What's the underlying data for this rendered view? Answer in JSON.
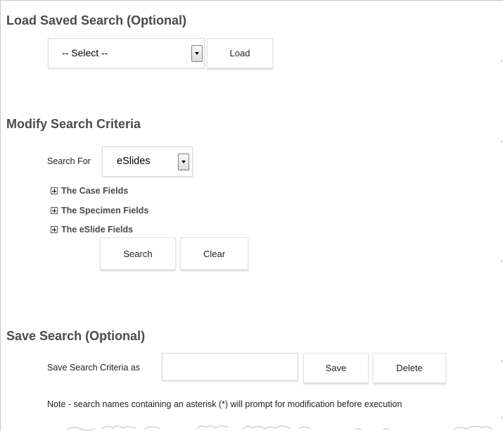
{
  "load_section": {
    "title": "Load Saved Search (Optional)",
    "select_value": "-- Select --",
    "load_button": "Load"
  },
  "modify_section": {
    "title": "Modify Search Criteria",
    "search_for_label": "Search For",
    "search_for_value": "eSlides",
    "tree_items": [
      "The Case Fields",
      "The Specimen Fields",
      "The eSlide Fields"
    ],
    "search_button": "Search",
    "clear_button": "Clear"
  },
  "save_section": {
    "title": "Save Search (Optional)",
    "save_as_label": "Save Search Criteria as",
    "save_as_value": "",
    "save_button": "Save",
    "delete_button": "Delete",
    "note": "Note - search names containing an asterisk (*) will prompt for modification before execution"
  }
}
